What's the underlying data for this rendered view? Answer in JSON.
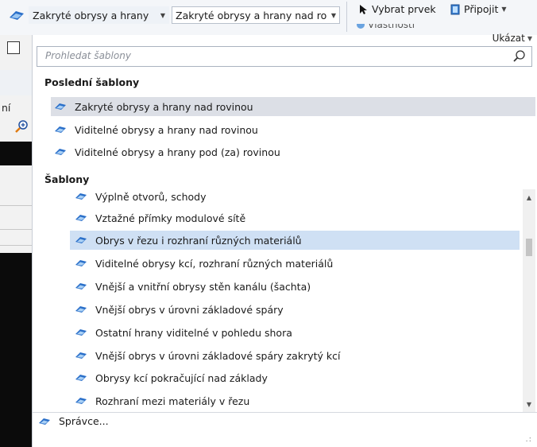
{
  "toolbar": {
    "style_combo": "Zakryté obrysy a hrany",
    "template_combo": "Zakryté obrysy a hrany nad ro",
    "select_label": "Vybrat prvek",
    "attach_label": "Připojit",
    "cut_label": "Vlastnosti"
  },
  "side": {
    "text": "ní"
  },
  "popup": {
    "show_label": "Ukázat",
    "search": {
      "placeholder": "Prohledat šablony"
    },
    "recent_title": "Poslední šablony",
    "recent": [
      "Zakryté obrysy a hrany nad rovinou",
      "Viditelné obrysy a hrany nad rovinou",
      "Viditelné obrysy a hrany pod (za) rovinou"
    ],
    "templates_title": "Šablony",
    "templates": [
      "Výplně otvorů, schody",
      "Vztažné přímky modulové sítě",
      "Obrys v řezu i rozhraní různých materiálů",
      "Viditelné obrysy kcí, rozhraní různých materiálů",
      "Vnější a vnitřní obrysy stěn kanálu (šachta)",
      "Vnější obrys v úrovni základové spáry",
      "Ostatní hrany viditelné v pohledu shora",
      "Vnější obrys v úrovni základové spáry zakrytý kcí",
      "Obrysy kcí pokračující nad základy",
      "Rozhraní mezi materiály v řezu"
    ],
    "manager_label": "Správce..."
  },
  "colors": {
    "selected_recent": "#dcdfe6",
    "selected_template": "#cfe0f4",
    "icon_blue": "#2a6fc9"
  }
}
